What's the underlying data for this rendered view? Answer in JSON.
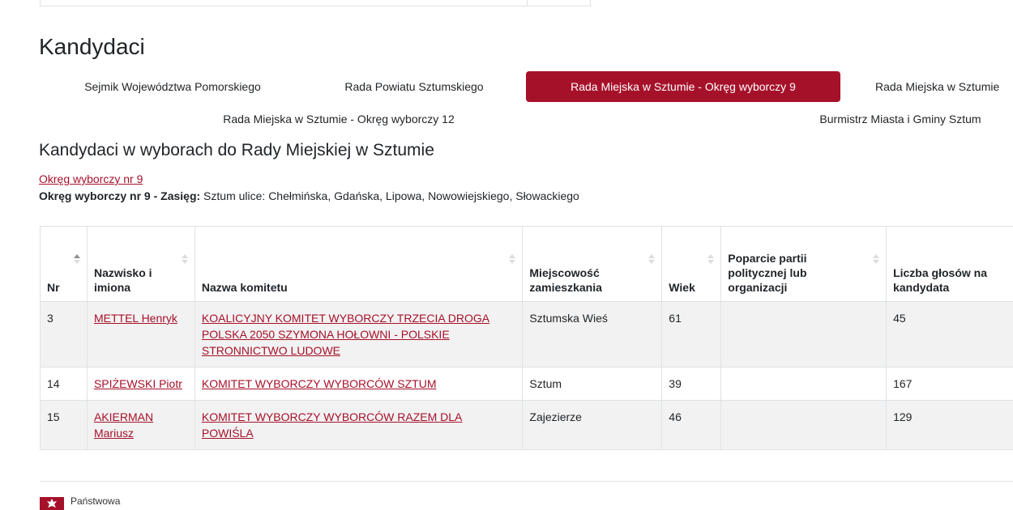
{
  "section_title": "Kandydaci",
  "tabs": [
    {
      "label": "Sejmik Województwa Pomorskiego",
      "active": false
    },
    {
      "label": "Rada Powiatu Sztumskiego",
      "active": false
    },
    {
      "label": "Rada Miejska w Sztumie - Okręg wyborczy 9",
      "active": true
    },
    {
      "label": "Rada Miejska w Sztumie",
      "active": false
    },
    {
      "label": "Rada Miejska w Sztumie - Okręg wyborczy 12",
      "active": false
    },
    {
      "label": "Burmistrz Miasta i Gminy Sztum",
      "active": false
    }
  ],
  "subtitle": "Kandydaci w wyborach do Rady Miejskiej w Sztumie",
  "district_link": "Okręg wyborczy nr 9",
  "district_info": {
    "label": "Okręg wyborczy nr 9 - Zasięg:",
    "value": " Sztum ulice: Chełmińska, Gdańska, Lipowa, Nowowiejskiego, Słowackiego"
  },
  "table": {
    "headers": [
      "Nr",
      "Nazwisko i imiona",
      "Nazwa komitetu",
      "Miejscowość zamieszkania",
      "Wiek",
      "Poparcie partii politycznej lub organizacji",
      "Liczba głosów na kandydata"
    ],
    "rows": [
      {
        "nr": "3",
        "name": "METTEL Henryk",
        "committee": "KOALICYJNY KOMITET WYBORCZY TRZECIA DROGA POLSKA 2050 SZYMONA HOŁOWNI - POLSKIE STRONNICTWO LUDOWE",
        "place": "Sztumska Wieś",
        "age": "61",
        "support": "",
        "votes": "45"
      },
      {
        "nr": "14",
        "name": "SPIŻEWSKI Piotr",
        "committee": "KOMITET WYBORCZY WYBORCÓW SZTUM",
        "place": "Sztum",
        "age": "39",
        "support": "",
        "votes": "167"
      },
      {
        "nr": "15",
        "name": "AKIERMAN Mariusz",
        "committee": "KOMITET WYBORCZY WYBORCÓW RAZEM DLA POWIŚLA",
        "place": "Zajezierze",
        "age": "46",
        "support": "",
        "votes": "129"
      }
    ]
  },
  "footer": {
    "logo_text": "Państwowa"
  },
  "colors": {
    "accent": "#a6112a",
    "row_alt": "#f2f2f2",
    "border": "#dee2e6"
  }
}
